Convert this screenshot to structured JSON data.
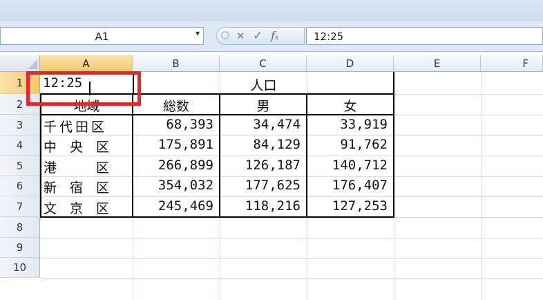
{
  "name_box": {
    "value": "A1"
  },
  "formula_bar": {
    "fx_label": "f",
    "fx_sub": "x",
    "content": "12:25",
    "cancel_glyph": "✕",
    "enter_glyph": "✓",
    "dropdown_glyph": "▾"
  },
  "columns": [
    "A",
    "B",
    "C",
    "D",
    "E",
    "F"
  ],
  "rows": [
    "1",
    "2",
    "3",
    "4",
    "5",
    "6",
    "7",
    "8",
    "9",
    "10"
  ],
  "cells": {
    "a1": "12:25",
    "b1": "人口",
    "a2": "地域",
    "b2": "総数",
    "c2": "男",
    "d2": "女",
    "a3": "千代田区",
    "a4": "中　央　区",
    "a5": "港　　　区",
    "a6": "新　宿　区",
    "a7": "文　京　区",
    "b3": "68,393",
    "c3": "34,474",
    "d3": "33,919",
    "b4": "175,891",
    "c4": "84,129",
    "d4": "91,762",
    "b5": "266,899",
    "c5": "126,187",
    "d5": "140,712",
    "b6": "354,032",
    "c6": "177,625",
    "d6": "176,407",
    "b7": "245,469",
    "c7": "118,216",
    "d7": "127,253"
  },
  "colors": {
    "highlight": "#e8262a",
    "header_active": "#f5c770"
  }
}
